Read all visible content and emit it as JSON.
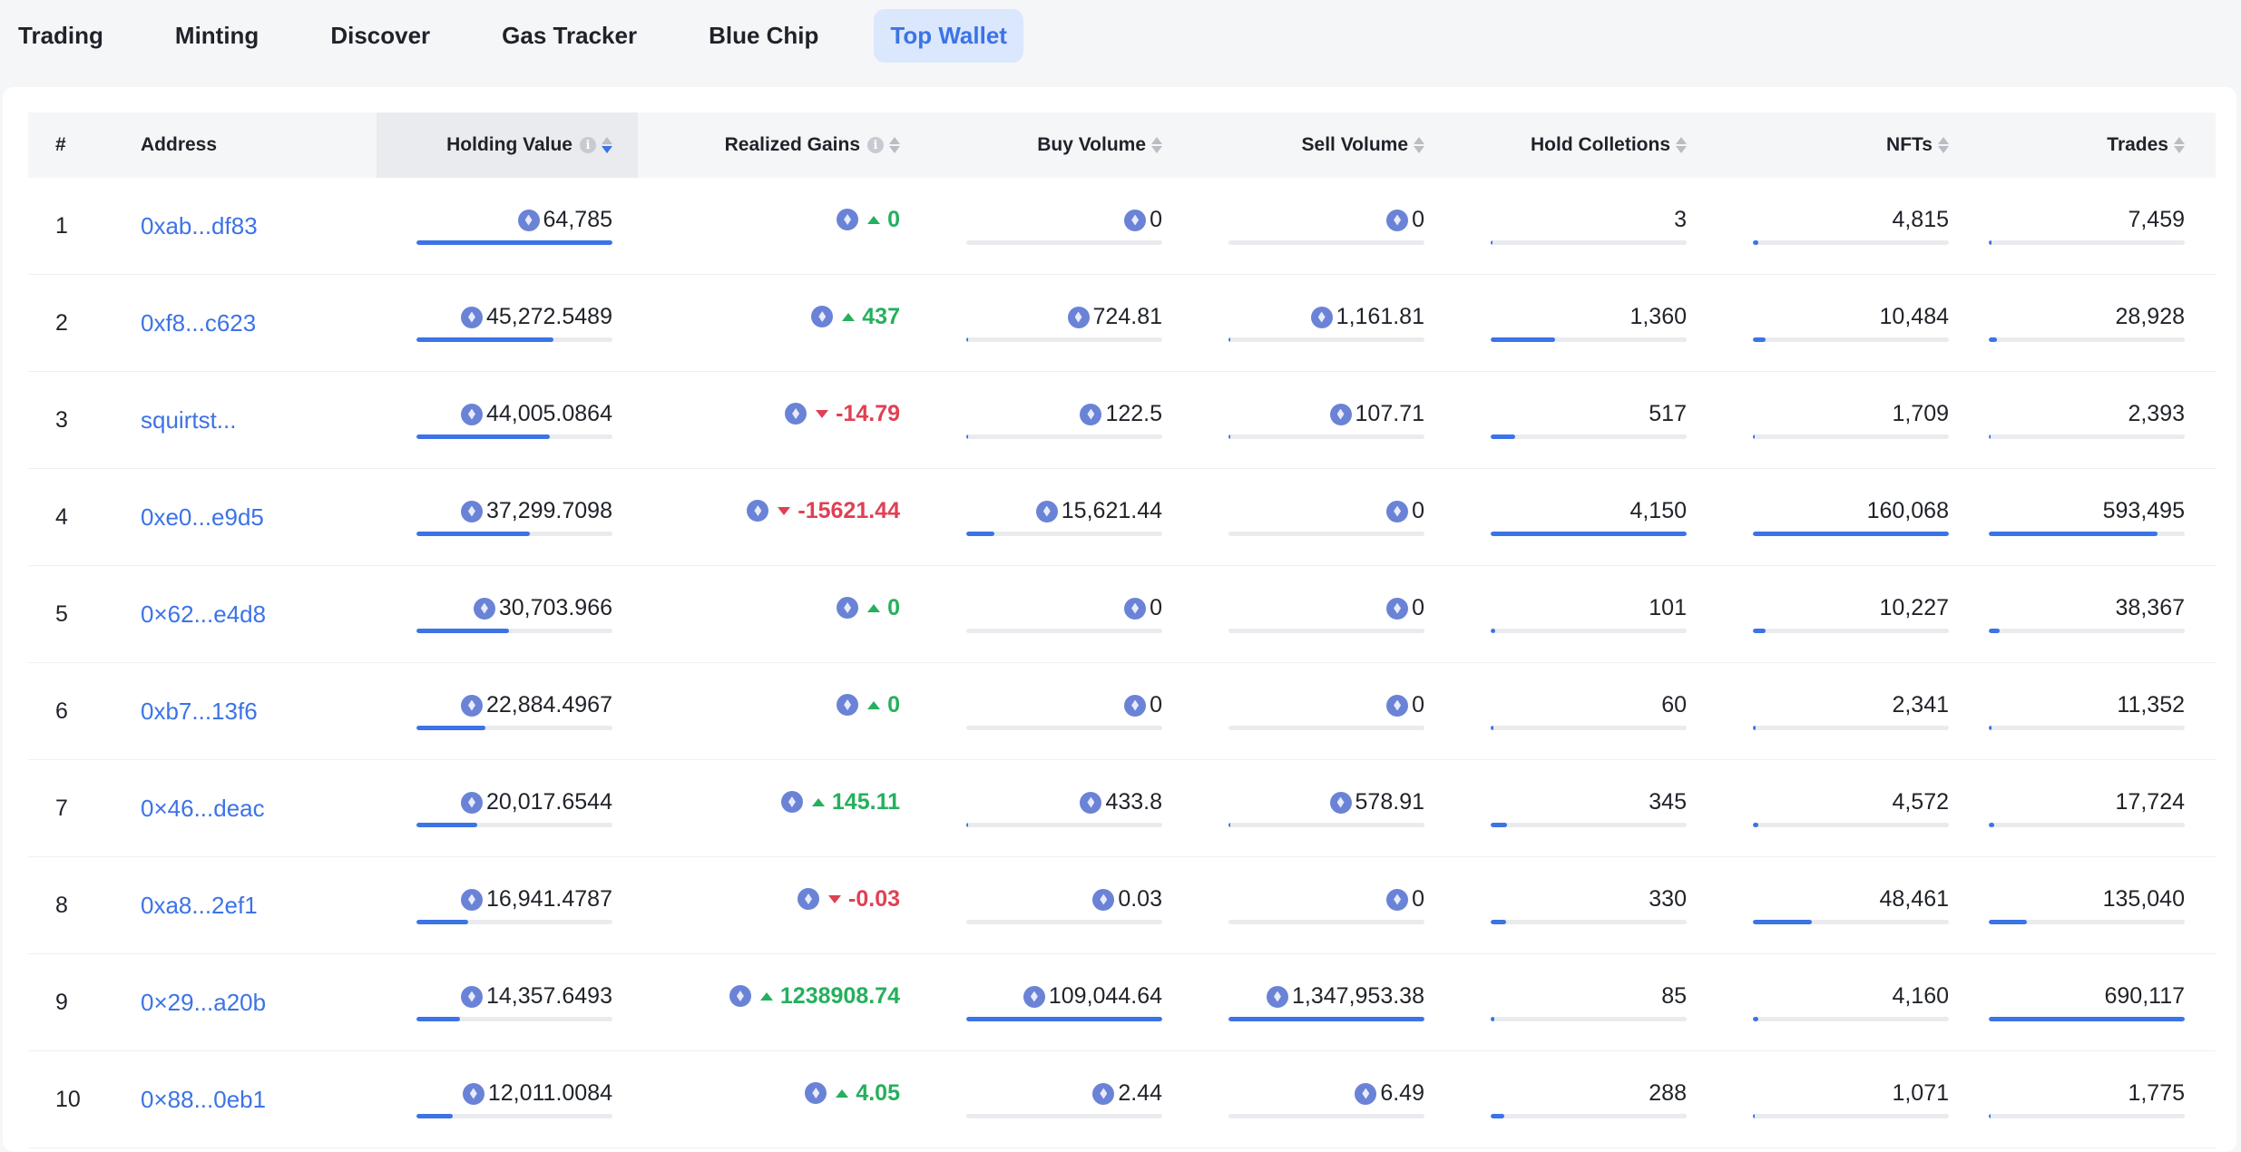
{
  "nav": {
    "tabs": [
      {
        "label": "Trading"
      },
      {
        "label": "Minting"
      },
      {
        "label": "Discover"
      },
      {
        "label": "Gas Tracker"
      },
      {
        "label": "Blue Chip"
      },
      {
        "label": "Top Wallet",
        "active": true
      }
    ]
  },
  "table": {
    "headers": {
      "rank": "#",
      "address": "Address",
      "holding_value": "Holding Value",
      "realized_gains": "Realized Gains",
      "buy_volume": "Buy Volume",
      "sell_volume": "Sell Volume",
      "hold_collections": "Hold Colletions",
      "nfts": "NFTs",
      "trades": "Trades"
    },
    "sorted_column": "holding_value",
    "sort_direction": "desc",
    "rows": [
      {
        "rank": "1",
        "address": "0xab...df83",
        "holding_value": "64,785",
        "realized_gains": "0",
        "gain_direction": "up",
        "buy_volume": "0",
        "sell_volume": "0",
        "hold_collections": "3",
        "nfts": "4,815",
        "trades": "7,459",
        "fill": {
          "holding_value": 1.0,
          "buy_volume": 0.0,
          "sell_volume": 0.0,
          "hold_collections": 0.007,
          "nfts": 0.03,
          "trades": 0.013
        }
      },
      {
        "rank": "2",
        "address": "0xf8...c623",
        "holding_value": "45,272.5489",
        "realized_gains": "437",
        "gain_direction": "up",
        "buy_volume": "724.81",
        "sell_volume": "1,161.81",
        "hold_collections": "1,360",
        "nfts": "10,484",
        "trades": "28,928",
        "fill": {
          "holding_value": 0.7,
          "buy_volume": 0.007,
          "sell_volume": 0.009,
          "hold_collections": 0.33,
          "nfts": 0.065,
          "trades": 0.042
        }
      },
      {
        "rank": "3",
        "address": "squirtst...",
        "holding_value": "44,005.0864",
        "realized_gains": "-14.79",
        "gain_direction": "down",
        "buy_volume": "122.5",
        "sell_volume": "107.71",
        "hold_collections": "517",
        "nfts": "1,709",
        "trades": "2,393",
        "fill": {
          "holding_value": 0.68,
          "buy_volume": 0.002,
          "sell_volume": 0.001,
          "hold_collections": 0.125,
          "nfts": 0.011,
          "trades": 0.004
        }
      },
      {
        "rank": "4",
        "address": "0xe0...e9d5",
        "holding_value": "37,299.7098",
        "realized_gains": "-15621.44",
        "gain_direction": "down",
        "buy_volume": "15,621.44",
        "sell_volume": "0",
        "hold_collections": "4,150",
        "nfts": "160,068",
        "trades": "593,495",
        "fill": {
          "holding_value": 0.58,
          "buy_volume": 0.143,
          "sell_volume": 0.0,
          "hold_collections": 1.0,
          "nfts": 1.0,
          "trades": 0.86
        }
      },
      {
        "rank": "5",
        "address": "0×62...e4d8",
        "holding_value": "30,703.966",
        "realized_gains": "0",
        "gain_direction": "up",
        "buy_volume": "0",
        "sell_volume": "0",
        "hold_collections": "101",
        "nfts": "10,227",
        "trades": "38,367",
        "fill": {
          "holding_value": 0.474,
          "buy_volume": 0.0,
          "sell_volume": 0.0,
          "hold_collections": 0.024,
          "nfts": 0.064,
          "trades": 0.056
        }
      },
      {
        "rank": "6",
        "address": "0xb7...13f6",
        "holding_value": "22,884.4967",
        "realized_gains": "0",
        "gain_direction": "up",
        "buy_volume": "0",
        "sell_volume": "0",
        "hold_collections": "60",
        "nfts": "2,341",
        "trades": "11,352",
        "fill": {
          "holding_value": 0.353,
          "buy_volume": 0.0,
          "sell_volume": 0.0,
          "hold_collections": 0.014,
          "nfts": 0.015,
          "trades": 0.016
        }
      },
      {
        "rank": "7",
        "address": "0×46...deac",
        "holding_value": "20,017.6544",
        "realized_gains": "145.11",
        "gain_direction": "up",
        "buy_volume": "433.8",
        "sell_volume": "578.91",
        "hold_collections": "345",
        "nfts": "4,572",
        "trades": "17,724",
        "fill": {
          "holding_value": 0.309,
          "buy_volume": 0.004,
          "sell_volume": 0.004,
          "hold_collections": 0.083,
          "nfts": 0.029,
          "trades": 0.026
        }
      },
      {
        "rank": "8",
        "address": "0xa8...2ef1",
        "holding_value": "16,941.4787",
        "realized_gains": "-0.03",
        "gain_direction": "down",
        "buy_volume": "0.03",
        "sell_volume": "0",
        "hold_collections": "330",
        "nfts": "48,461",
        "trades": "135,040",
        "fill": {
          "holding_value": 0.262,
          "buy_volume": 0.0,
          "sell_volume": 0.0,
          "hold_collections": 0.08,
          "nfts": 0.303,
          "trades": 0.196
        }
      },
      {
        "rank": "9",
        "address": "0×29...a20b",
        "holding_value": "14,357.6493",
        "realized_gains": "1238908.74",
        "gain_direction": "up",
        "buy_volume": "109,044.64",
        "sell_volume": "1,347,953.38",
        "hold_collections": "85",
        "nfts": "4,160",
        "trades": "690,117",
        "fill": {
          "holding_value": 0.222,
          "buy_volume": 1.0,
          "sell_volume": 1.0,
          "hold_collections": 0.02,
          "nfts": 0.026,
          "trades": 1.0
        }
      },
      {
        "rank": "10",
        "address": "0×88...0eb1",
        "holding_value": "12,011.0084",
        "realized_gains": "4.05",
        "gain_direction": "up",
        "buy_volume": "2.44",
        "sell_volume": "6.49",
        "hold_collections": "288",
        "nfts": "1,071",
        "trades": "1,775",
        "fill": {
          "holding_value": 0.185,
          "buy_volume": 0.0,
          "sell_volume": 0.0,
          "hold_collections": 0.069,
          "nfts": 0.007,
          "trades": 0.003
        }
      }
    ]
  },
  "icons": {
    "currency": "eth-icon",
    "info": "info-icon",
    "sort": "sort-icon"
  },
  "colors": {
    "accent": "#3c73e6",
    "positive": "#25b05d",
    "negative": "#e04054",
    "active_tab_bg": "#dbe7fd"
  }
}
